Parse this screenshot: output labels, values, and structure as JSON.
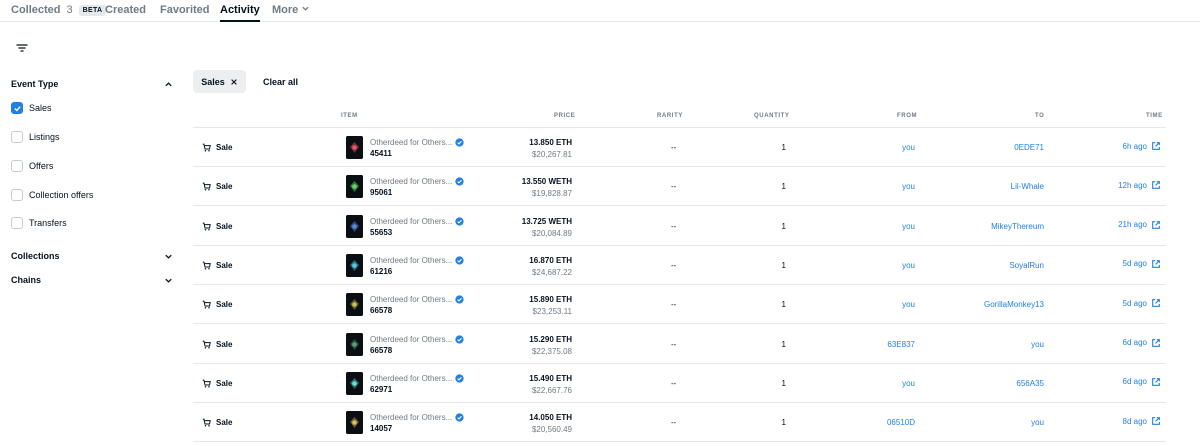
{
  "tabs": [
    {
      "label": "Collected",
      "count": "3",
      "badge": "BETA"
    },
    {
      "label": "Created"
    },
    {
      "label": "Favorited"
    },
    {
      "label": "Activity"
    },
    {
      "label": "More"
    }
  ],
  "sidebar": {
    "event_type": "Event Type",
    "options": [
      "Sales",
      "Listings",
      "Offers",
      "Collection offers",
      "Transfers"
    ],
    "collections": "Collections",
    "chains": "Chains"
  },
  "chip": {
    "label": "Sales"
  },
  "clear_all": "Clear all",
  "columns": {
    "item": "ITEM",
    "price": "PRICE",
    "rarity": "RARITY",
    "quantity": "QUANTITY",
    "from": "FROM",
    "to": "TO",
    "time": "TIME"
  },
  "rows": [
    {
      "event": "Sale",
      "name": "Otherdeed for Others...",
      "id": "45411",
      "price": "13.850 ETH",
      "usd": "$20,267.81",
      "rarity": "--",
      "qty": "1",
      "from": "you",
      "to": "0EDE71",
      "time": "6h ago"
    },
    {
      "event": "Sale",
      "name": "Otherdeed for Others...",
      "id": "95061",
      "price": "13.550 WETH",
      "usd": "$19,828.87",
      "rarity": "--",
      "qty": "1",
      "from": "you",
      "to": "Lil-Whale",
      "time": "12h ago"
    },
    {
      "event": "Sale",
      "name": "Otherdeed for Others...",
      "id": "55653",
      "price": "13.725 WETH",
      "usd": "$20,084.89",
      "rarity": "--",
      "qty": "1",
      "from": "you",
      "to": "MikeyThereum",
      "time": "21h ago"
    },
    {
      "event": "Sale",
      "name": "Otherdeed for Others...",
      "id": "61216",
      "price": "16.870 ETH",
      "usd": "$24,687.22",
      "rarity": "--",
      "qty": "1",
      "from": "you",
      "to": "SoyalRun",
      "time": "5d ago"
    },
    {
      "event": "Sale",
      "name": "Otherdeed for Others...",
      "id": "66578",
      "price": "15.890 ETH",
      "usd": "$23,253.11",
      "rarity": "--",
      "qty": "1",
      "from": "you",
      "to": "GorillaMonkey13",
      "time": "5d ago"
    },
    {
      "event": "Sale",
      "name": "Otherdeed for Others...",
      "id": "66578",
      "price": "15.290 ETH",
      "usd": "$22,375.08",
      "rarity": "--",
      "qty": "1",
      "from": "63E837",
      "to": "you",
      "time": "6d ago"
    },
    {
      "event": "Sale",
      "name": "Otherdeed for Others...",
      "id": "62971",
      "price": "15.490 ETH",
      "usd": "$22,667.76",
      "rarity": "--",
      "qty": "1",
      "from": "you",
      "to": "656A35",
      "time": "6d ago"
    },
    {
      "event": "Sale",
      "name": "Otherdeed for Others...",
      "id": "14057",
      "price": "14.050 ETH",
      "usd": "$20,560.49",
      "rarity": "--",
      "qty": "1",
      "from": "06510D",
      "to": "you",
      "time": "8d ago"
    }
  ],
  "colors": {
    "link": "#2081e2",
    "text": "#04111d",
    "muted": "#707a83",
    "border": "#e5e8eb"
  }
}
